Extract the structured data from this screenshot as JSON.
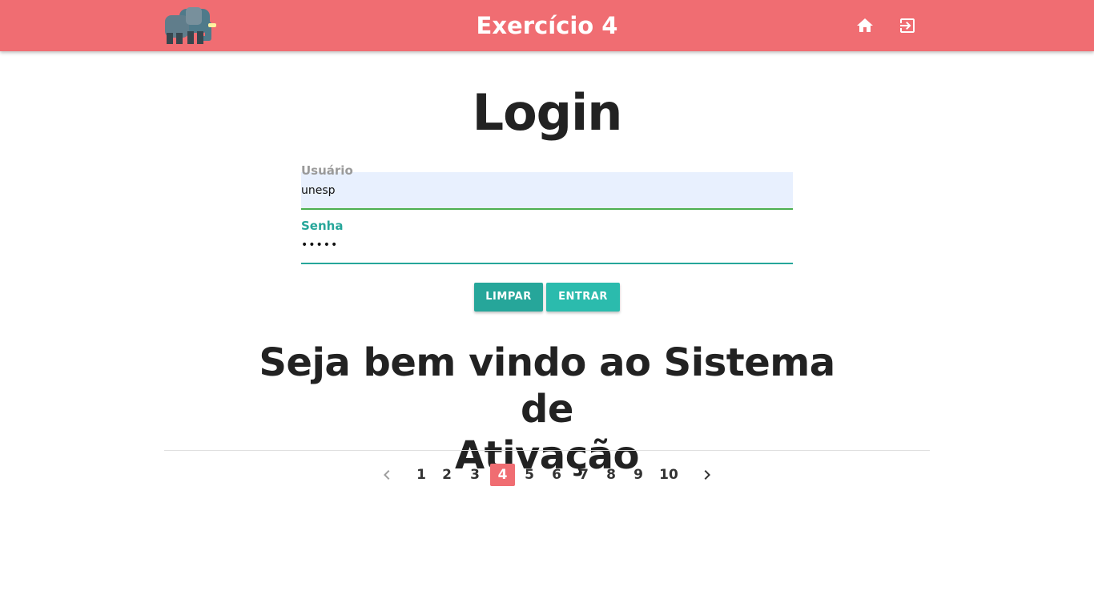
{
  "header": {
    "title": "Exercício 4",
    "logo": "elephant-logo",
    "bg_color": "#f06d72",
    "icons": [
      "home-icon",
      "exit-to-app-icon"
    ]
  },
  "login": {
    "title": "Login",
    "user_label": "Usuário",
    "user_value": "unesp",
    "password_label": "Senha",
    "password_value": "•••••",
    "clear_button": "LIMPAR",
    "enter_button": "ENTRAR",
    "accent_color": "#26a69a"
  },
  "welcome": {
    "line1": "Seja bem vindo ao Sistema de",
    "line2": "Ativação"
  },
  "pagination": {
    "pages": [
      "1",
      "2",
      "3",
      "4",
      "5",
      "6",
      "7",
      "8",
      "9",
      "10"
    ],
    "active": "4",
    "prev_icon": "chevron-left-icon",
    "next_icon": "chevron-right-icon"
  }
}
